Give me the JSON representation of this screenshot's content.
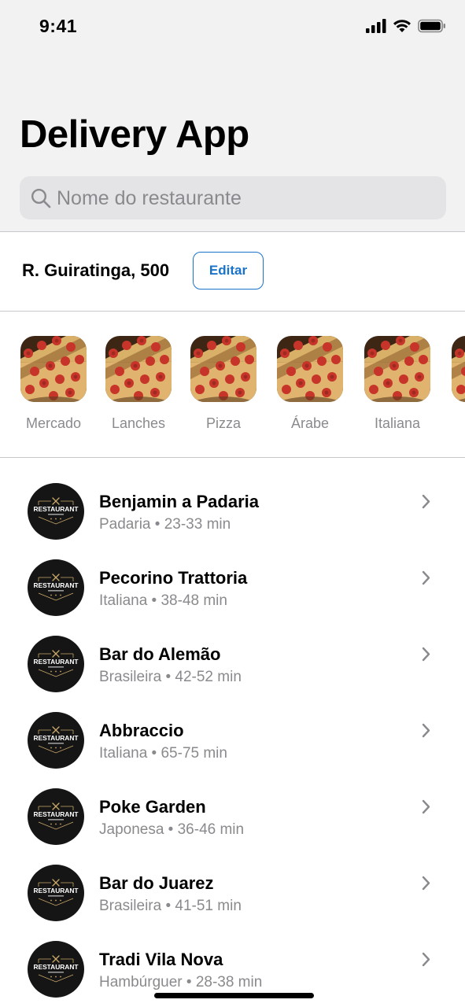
{
  "status_bar": {
    "time": "9:41"
  },
  "header": {
    "title": "Delivery App"
  },
  "search": {
    "placeholder": "Nome do restaurante"
  },
  "address": {
    "text": "R. Guiratinga, 500",
    "edit_label": "Editar"
  },
  "categories": [
    {
      "label": "Mercado"
    },
    {
      "label": "Lanches"
    },
    {
      "label": "Pizza"
    },
    {
      "label": "Árabe"
    },
    {
      "label": "Italiana"
    }
  ],
  "restaurants": [
    {
      "name": "Benjamin a Padaria",
      "subtitle": "Padaria • 23-33 min"
    },
    {
      "name": "Pecorino Trattoria",
      "subtitle": "Italiana • 38-48 min"
    },
    {
      "name": "Bar do Alemão",
      "subtitle": "Brasileira • 42-52 min"
    },
    {
      "name": "Abbraccio",
      "subtitle": "Italiana • 65-75 min"
    },
    {
      "name": "Poke Garden",
      "subtitle": "Japonesa • 36-46 min"
    },
    {
      "name": "Bar do Juarez",
      "subtitle": "Brasileira • 41-51 min"
    },
    {
      "name": "Tradi Vila Nova",
      "subtitle": "Hambúrguer • 28-38 min"
    }
  ],
  "logo_text": "RESTAURANT",
  "colors": {
    "accent": "#1a73c9",
    "secondary_text": "#8a8a8e",
    "background_top": "#f2f2f3"
  }
}
